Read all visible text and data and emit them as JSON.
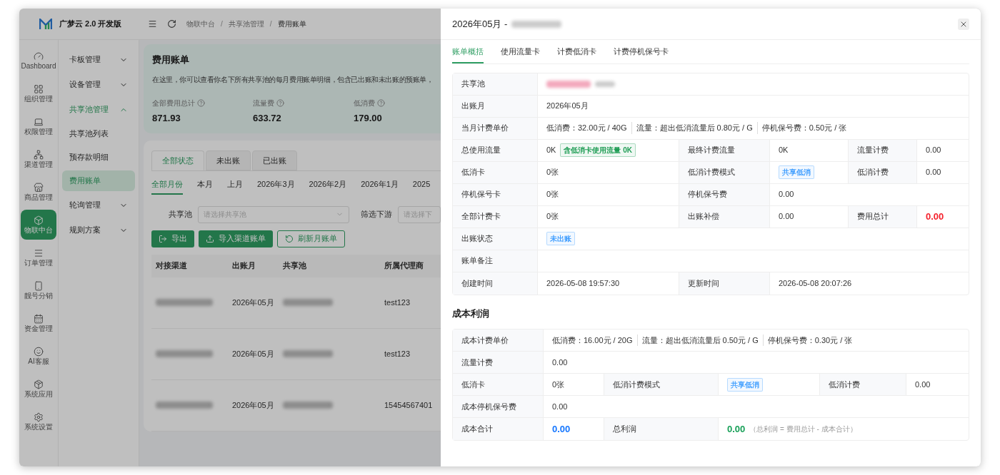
{
  "app": {
    "logo_text": "广梦云 2.0 开发版"
  },
  "rail": [
    {
      "label": "Dashboard",
      "selected": false
    },
    {
      "label": "组织管理",
      "selected": false
    },
    {
      "label": "权限管理",
      "selected": false
    },
    {
      "label": "渠道管理",
      "selected": false
    },
    {
      "label": "商品管理",
      "selected": false
    },
    {
      "label": "物联中台",
      "selected": true
    },
    {
      "label": "订单管理",
      "selected": false
    },
    {
      "label": "靓号分销",
      "selected": false
    },
    {
      "label": "资金管理",
      "selected": false
    },
    {
      "label": "AI客服",
      "selected": false
    },
    {
      "label": "系统应用",
      "selected": false
    },
    {
      "label": "系统设置",
      "selected": false
    }
  ],
  "menu": [
    {
      "label": "卡板管理",
      "expanded": false
    },
    {
      "label": "设备管理",
      "expanded": false
    },
    {
      "label": "共享池管理",
      "expanded": true,
      "children": [
        {
          "label": "共享池列表",
          "selected": false
        },
        {
          "label": "预存款明细",
          "selected": false
        },
        {
          "label": "费用账单",
          "selected": true
        }
      ]
    },
    {
      "label": "轮询管理",
      "expanded": false
    },
    {
      "label": "规则方案",
      "expanded": false
    }
  ],
  "breadcrumb": [
    {
      "text": "物联中台",
      "kind": "link"
    },
    {
      "text": "/",
      "kind": "separator"
    },
    {
      "text": "共享池管理",
      "kind": "link"
    },
    {
      "text": "/",
      "kind": "separator"
    },
    {
      "text": "费用账单",
      "kind": "current"
    }
  ],
  "summary": {
    "title": "费用账单",
    "description": "在这里，你可以查看你名下所有共享池的每月费用账单明细，包含已出账和未出账的预账单，",
    "stats": [
      {
        "label": "全部费用总计",
        "value": "871.93"
      },
      {
        "label": "流量费",
        "value": "633.72"
      },
      {
        "label": "低消费",
        "value": "179.00"
      }
    ]
  },
  "status_tabs": [
    {
      "label": "全部状态",
      "selected": true
    },
    {
      "label": "未出账",
      "selected": false
    },
    {
      "label": "已出账",
      "selected": false
    }
  ],
  "month_tabs": [
    {
      "label": "全部月份",
      "selected": true
    },
    {
      "label": "本月",
      "selected": false
    },
    {
      "label": "上月",
      "selected": false
    },
    {
      "label": "2026年3月",
      "selected": false
    },
    {
      "label": "2026年2月",
      "selected": false
    },
    {
      "label": "2026年1月",
      "selected": false
    },
    {
      "label": "2025",
      "selected": false
    }
  ],
  "filters": [
    {
      "label": "共享池",
      "placeholder": "请选择共享池",
      "kind": "select"
    },
    {
      "label": "筛选下游",
      "placeholder": "请选择下",
      "kind": "input"
    }
  ],
  "actions": [
    {
      "label": "导出",
      "kind": "primary"
    },
    {
      "label": "导入渠道账单",
      "kind": "primary"
    },
    {
      "label": "刷新月账单",
      "kind": "outline"
    }
  ],
  "table": {
    "columns": [
      "对接渠道",
      "出账月",
      "共享池",
      "所属代理商"
    ],
    "rows": [
      {
        "month": "2026年05月",
        "agent": "test123"
      },
      {
        "month": "2026年05月",
        "agent": "test123"
      },
      {
        "month": "2026年05月",
        "agent": "15454567401"
      }
    ]
  },
  "drawer": {
    "title": "2026年05月 -",
    "tabs": [
      {
        "label": "账单概括",
        "selected": true
      },
      {
        "label": "使用流量卡",
        "selected": false
      },
      {
        "label": "计费低消卡",
        "selected": false
      },
      {
        "label": "计费停机保号卡",
        "selected": false
      }
    ],
    "bill": [
      [
        {
          "label": "共享池",
          "redacted": true
        }
      ],
      [
        {
          "label": "出账月",
          "value": "2026年05月"
        }
      ],
      [
        {
          "label": "当月计费单价",
          "parts": [
            {
              "label": "低消费：",
              "value": "32.00元 / 40G"
            },
            {
              "label": "流量：",
              "value": "超出低消流量后 0.80元 / G"
            },
            {
              "label": "停机保号费：",
              "value": "0.50元 / 张"
            }
          ]
        }
      ],
      [
        {
          "label": "总使用流量",
          "value": "0K",
          "tag": {
            "text": "含低消卡使用流量 0K",
            "color": "#1f9d55"
          }
        },
        {
          "label": "最终计费流量",
          "value": "0K"
        },
        {
          "label": "流量计费",
          "value": "0.00"
        }
      ],
      [
        {
          "label": "低消卡",
          "value": "0张"
        },
        {
          "label": "低消计费模式",
          "tag": {
            "text": "共享低消",
            "color": "#409eff"
          }
        },
        {
          "label": "低消计费",
          "value": "0.00"
        }
      ],
      [
        {
          "label": "停机保号卡",
          "value": "0张"
        },
        {
          "label": "停机保号费",
          "value": "0.00"
        }
      ],
      [
        {
          "label": "全部计费卡",
          "value": "0张"
        },
        {
          "label": "出账补偿",
          "value": "0.00"
        },
        {
          "label": "费用总计",
          "value": "0.00",
          "color": "#f5222d"
        }
      ],
      [
        {
          "label": "出账状态",
          "tag": {
            "text": "未出账",
            "color": "#409eff"
          }
        }
      ],
      [
        {
          "label": "账单备注"
        }
      ],
      [
        {
          "label": "创建时间",
          "value": "2026-05-08 19:57:30"
        },
        {
          "label": "更新时间",
          "value": "2026-05-08 20:07:26"
        }
      ]
    ],
    "cost_title": "成本利润",
    "cost": [
      [
        {
          "label": "成本计费单价",
          "parts": [
            {
              "label": "低消费：",
              "value": "16.00元 / 20G"
            },
            {
              "label": "流量：",
              "value": "超出低消流量后 0.50元 / G"
            },
            {
              "label": "停机保号费：",
              "value": "0.30元 / 张"
            }
          ]
        }
      ],
      [
        {
          "label": "流量计费",
          "value": "0.00"
        }
      ],
      [
        {
          "label": "低消卡",
          "value": "0张"
        },
        {
          "label": "低消计费模式",
          "tag": {
            "text": "共享低消",
            "color": "#409eff"
          }
        },
        {
          "label": "低消计费",
          "value": "0.00"
        }
      ],
      [
        {
          "label": "成本停机保号费",
          "value": "0.00"
        }
      ],
      [
        {
          "label": "成本合计",
          "value": "0.00",
          "color": "#1677ff"
        },
        {
          "label": "总利润",
          "value": "0.00",
          "color": "#18a058",
          "note": "（总利润 = 费用总计 - 成本合计）"
        }
      ]
    ]
  }
}
